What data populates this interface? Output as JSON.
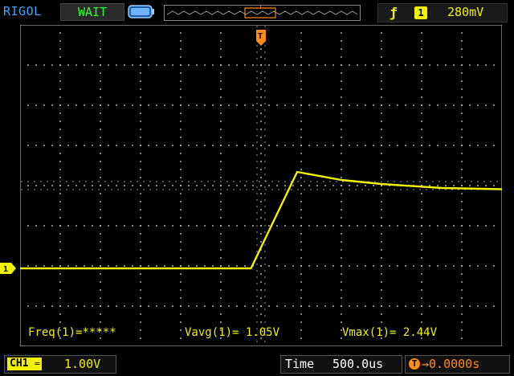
{
  "header": {
    "brand": "RIGOL",
    "run_status": "WAIT",
    "trigger": {
      "edge_symbol": "ƒ",
      "source": "1",
      "level": "280mV"
    },
    "trigger_marker": "T"
  },
  "channel": {
    "marker": "1",
    "tag": "CH1",
    "scale": "1.00V"
  },
  "measurements": {
    "freq": "Freq(1)=*****",
    "vavg": "Vavg(1)= 1.05V",
    "vmax": "Vmax(1)= 2.44V"
  },
  "timebase": {
    "label": "Time",
    "value": "500.0us",
    "offset_icon": "T",
    "offset": "→0.0000s"
  },
  "colors": {
    "channel1": "#f2f200",
    "trigger": "#ff8a1a",
    "grid": "#cfcfcf",
    "brand": "#3aa8ff",
    "status": "#2bff2b"
  },
  "waveform": {
    "time_per_div_us": 500,
    "volts_per_div": 1.0,
    "points_div": [
      [
        0,
        0
      ],
      [
        5.75,
        0
      ],
      [
        6.9,
        2.4
      ],
      [
        8.0,
        2.2
      ],
      [
        9.0,
        2.1
      ],
      [
        10.5,
        2.0
      ],
      [
        12.0,
        1.97
      ]
    ]
  }
}
